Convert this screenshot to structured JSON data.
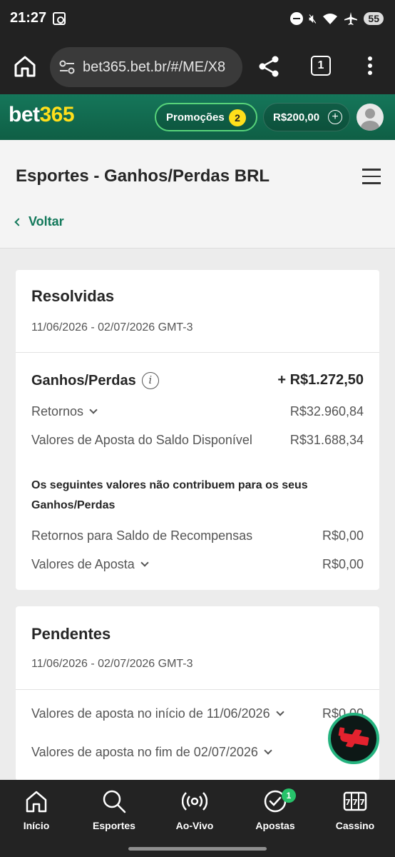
{
  "status_bar": {
    "time": "21:27",
    "battery": "55"
  },
  "browser": {
    "url": "bet365.bet.br/#/ME/X8",
    "tab_count": "1"
  },
  "site_header": {
    "logo_black_part": "bet",
    "logo_yellow_part": "365",
    "promotions_label": "Promoções",
    "promotions_count": "2",
    "balance": "R$200,00",
    "brand_green": "#126e51",
    "brand_yellow": "#ffdf1b"
  },
  "page": {
    "title": "Esportes - Ganhos/Perdas BRL",
    "back_label": "Voltar"
  },
  "resolved": {
    "title": "Resolvidas",
    "date_range": "11/06/2026 - 02/07/2026 GMT-3",
    "profit_loss_label": "Ganhos/Perdas",
    "profit_loss_value": "+ R$1.272,50",
    "returns_label": "Retornos",
    "returns_value": "R$32.960,84",
    "stakes_label": "Valores de Aposta do Saldo Disponível",
    "stakes_value": "R$31.688,34",
    "note": "Os seguintes valores não contribuem para os seus Ganhos/Perdas",
    "reward_returns_label": "Retornos para Saldo de Recompensas",
    "reward_returns_value": "R$0,00",
    "bet_values_label": "Valores de Aposta",
    "bet_values_value": "R$0,00"
  },
  "pending": {
    "title": "Pendentes",
    "date_range": "11/06/2026 - 02/07/2026 GMT-3",
    "start_label": "Valores de aposta no início de 11/06/2026",
    "start_value": "R$0,00",
    "end_label": "Valores de aposta no fim de 02/07/2026",
    "end_value": "R$"
  },
  "bottom_nav": {
    "items": [
      {
        "label": "Início",
        "icon": "home-icon"
      },
      {
        "label": "Esportes",
        "icon": "search-icon"
      },
      {
        "label": "Ao-Vivo",
        "icon": "live-broadcast-icon"
      },
      {
        "label": "Apostas",
        "icon": "check-circle-icon"
      },
      {
        "label": "Cassino",
        "icon": "slot-machine-icon"
      }
    ],
    "bets_badge": "1"
  }
}
